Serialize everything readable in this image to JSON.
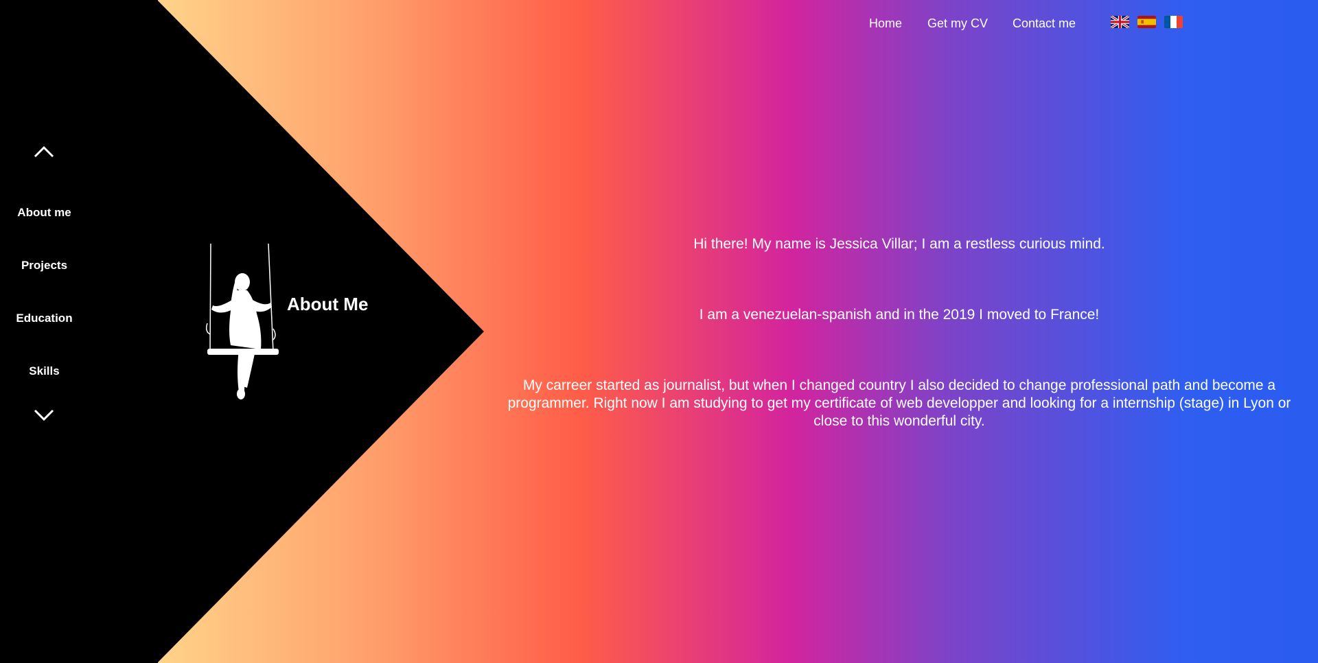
{
  "topnav": {
    "home": "Home",
    "cv": "Get my CV",
    "contact": "Contact me"
  },
  "languages": [
    {
      "icon": "uk-flag-icon",
      "colors": [
        "#012169",
        "#ffffff",
        "#c8102e"
      ]
    },
    {
      "icon": "spain-flag-icon",
      "colors": [
        "#aa151b",
        "#f1bf00"
      ]
    },
    {
      "icon": "france-flag-icon",
      "colors": [
        "#0055a4",
        "#ffffff",
        "#ef4135"
      ]
    }
  ],
  "sidebar": {
    "up_icon": "chevron-up-icon",
    "down_icon": "chevron-down-icon",
    "items": [
      {
        "label": "About me"
      },
      {
        "label": "Projects"
      },
      {
        "label": "Education"
      },
      {
        "label": "Skills"
      }
    ]
  },
  "section": {
    "title": "About Me",
    "icon": "girl-on-swing-icon"
  },
  "about": {
    "p1": "Hi there! My name is Jessica Villar; I am a restless curious mind.",
    "p2": "I am a venezuelan-spanish and in the 2019 I moved to France!",
    "p3": "My carreer started as journalist, but when I changed country I also decided to change professional path and become a programmer. Right now I am studying to get my certificate of web developper and looking for a internship (stage) in Lyon or close to this wonderful city."
  },
  "colors": {
    "sidebar": "#000000",
    "gradient": [
      "#ffd38a",
      "#ff5d48",
      "#d3249e",
      "#2a5cf0"
    ],
    "text": "#ffffff"
  }
}
